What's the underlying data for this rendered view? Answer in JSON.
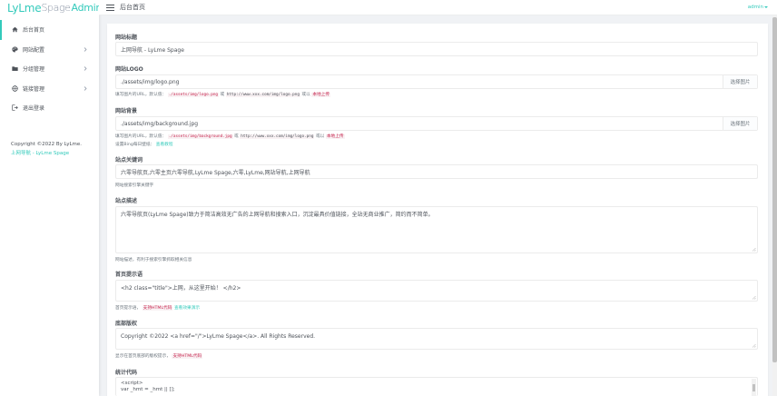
{
  "logo": {
    "part1": "LyLme",
    "part2": "Spage",
    "part3": "Admin"
  },
  "sidebar": {
    "items": [
      {
        "label": "后台首页",
        "icon": "home-icon",
        "active": true
      },
      {
        "label": "网站配置",
        "icon": "palette-icon",
        "has_arrow": true
      },
      {
        "label": "分组管理",
        "icon": "folder-icon",
        "has_arrow": true
      },
      {
        "label": "链接管理",
        "icon": "globe-icon",
        "has_arrow": true
      },
      {
        "label": "退出登录",
        "icon": "logout-icon"
      }
    ],
    "copyright": "Copyright ©2022 By LyLme.",
    "copyright_link": "上网导航 - LyLme Spage"
  },
  "topbar": {
    "title": "后台首页",
    "user": "admin"
  },
  "form": {
    "site_title": {
      "label": "网站标题",
      "value": "上网导航 - LyLme Spage"
    },
    "site_logo": {
      "label": "网站LOGO",
      "value": "./assets/img/logo.png",
      "button": "选择图片",
      "help_prefix": "填写图片的URL，默认值：",
      "help_code1": "./assets/img/logo.png",
      "help_or1": "或",
      "help_code2": "http://www.xxx.com/img/logo.png",
      "help_or2": "或以",
      "help_upload": "本地上传"
    },
    "site_bg": {
      "label": "网站背景",
      "value": "./assets/img/background.jpg",
      "button": "选择图片",
      "help_prefix": "填写图片的URL，默认值：",
      "help_code1": "./assets/img/background.jpg",
      "help_or1": "或",
      "help_code2": "http://www.xxx.com/img/logo.png",
      "help_or2": "或以",
      "help_upload": "本地上传",
      "help2_prefix": "设置Bing每日壁纸：",
      "help2_link": "查看教程"
    },
    "keywords": {
      "label": "站点关键词",
      "value": "六零导航页,六零主页六零导航,LyLme Spage,六零,LyLme,网站导航,上网导航",
      "help": "网站搜索引擎关键字"
    },
    "description": {
      "label": "站点描述",
      "value": "六零导航页(LyLme Spage)致力于简洁高效无广告的上网导航和搜索入口，沉淀最具价值链接，全站无商业推广，简约而不简单。",
      "help": "网站描述，有利于搜索引擎抓取相关信息"
    },
    "home_tip": {
      "label": "首页提示语",
      "value": "<h2 class=\"title\">上网，从这里开始！ </h2>",
      "help_prefix": "首页提示语，",
      "help_red": "支持HTML代码",
      "help_link": "查看效果演示"
    },
    "footer": {
      "label": "底部版权",
      "value": "Copyright ©2022 <a href=\"/\">LyLme Spage</a>.  All Rights Reserved.",
      "help_prefix": "显示在首页底部的版权提示，",
      "help_red": "支持HTML代码"
    },
    "stats": {
      "label": "统计代码",
      "line1": "<script>",
      "line2": "var _hmt = _hmt || [];"
    }
  }
}
